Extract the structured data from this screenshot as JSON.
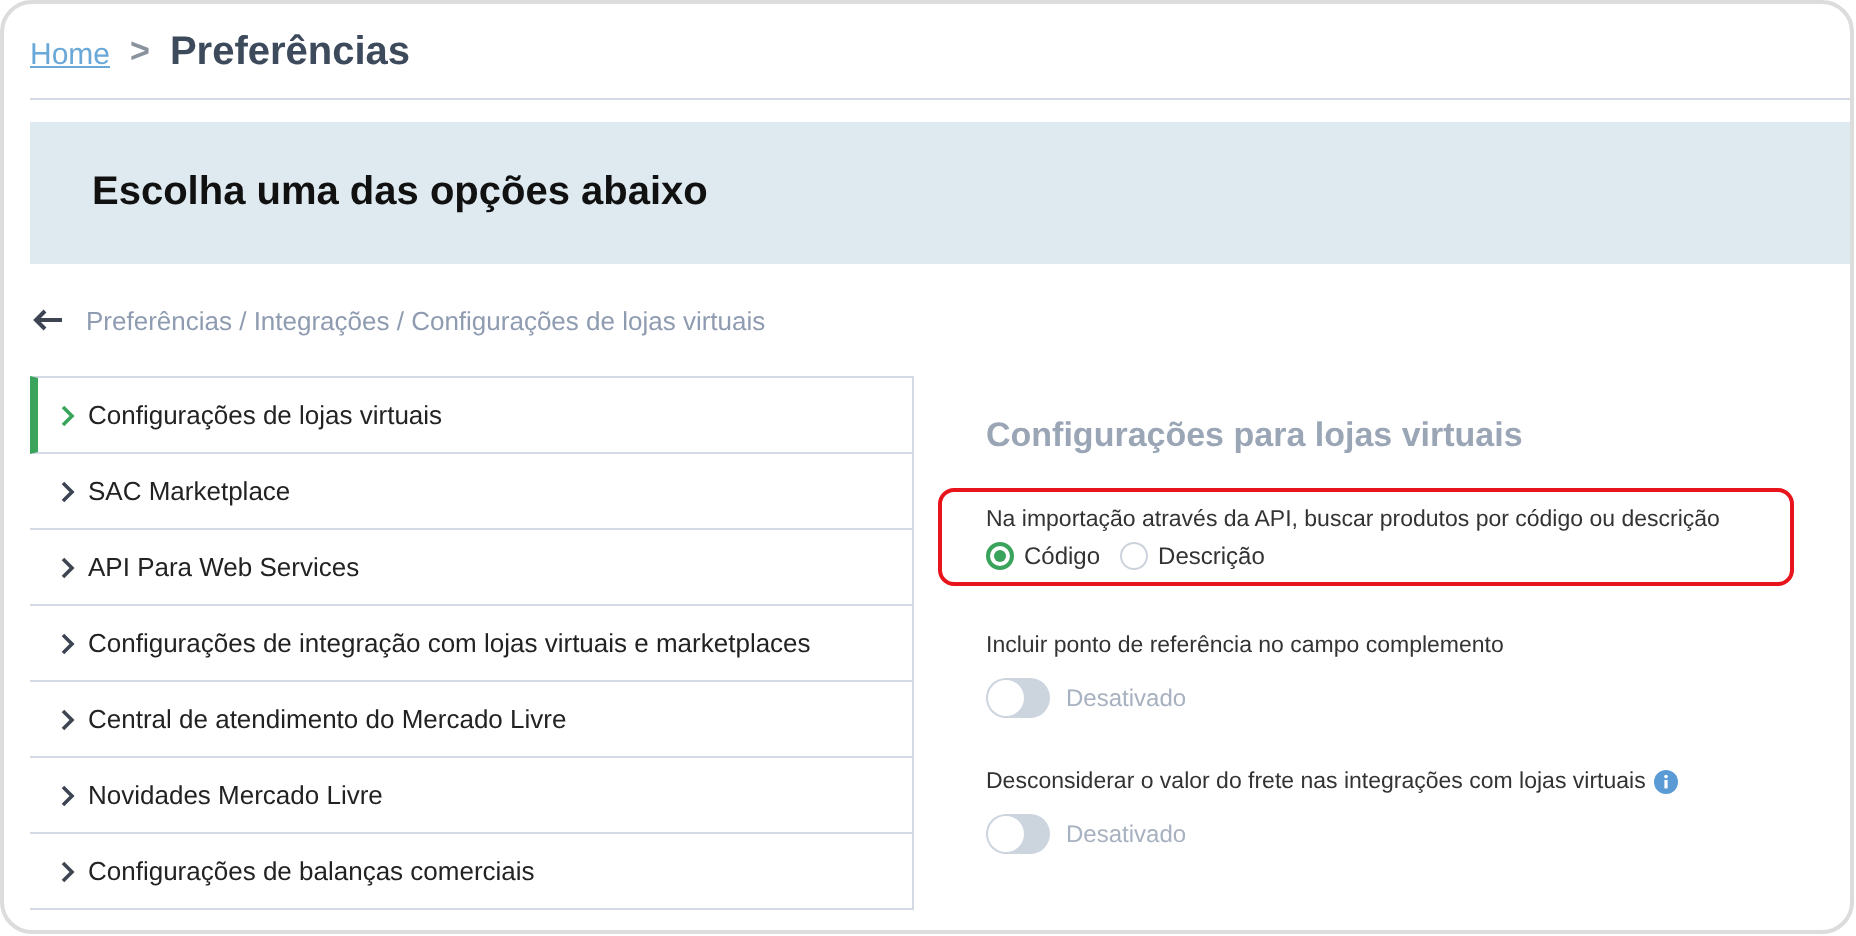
{
  "breadcrumb": {
    "home": "Home",
    "separator": ">",
    "current": "Preferências"
  },
  "banner": {
    "title": "Escolha uma das opções abaixo"
  },
  "path": "Preferências / Integrações / Configurações de lojas virtuais",
  "menu": [
    {
      "label": "Configurações de lojas virtuais",
      "selected": true
    },
    {
      "label": "SAC Marketplace",
      "selected": false
    },
    {
      "label": "API Para Web Services",
      "selected": false
    },
    {
      "label": "Configurações de integração com lojas virtuais e marketplaces",
      "selected": false
    },
    {
      "label": "Central de atendimento do Mercado Livre",
      "selected": false
    },
    {
      "label": "Novidades Mercado Livre",
      "selected": false
    },
    {
      "label": "Configurações de balanças comerciais",
      "selected": false
    }
  ],
  "panel": {
    "title": "Configurações para lojas virtuais",
    "settings": [
      {
        "kind": "radio",
        "label": "Na importação através da API, buscar produtos por código ou descrição",
        "highlighted": true,
        "info": false,
        "options": [
          {
            "label": "Código",
            "selected": true
          },
          {
            "label": "Descrição",
            "selected": false
          }
        ]
      },
      {
        "kind": "toggle",
        "label": "Incluir ponto de referência no campo complemento",
        "highlighted": false,
        "info": false,
        "on": false,
        "state_label": "Desativado"
      },
      {
        "kind": "toggle",
        "label": "Desconsiderar o valor do frete nas integrações com lojas virtuais",
        "highlighted": false,
        "info": true,
        "on": false,
        "state_label": "Desativado"
      }
    ]
  }
}
